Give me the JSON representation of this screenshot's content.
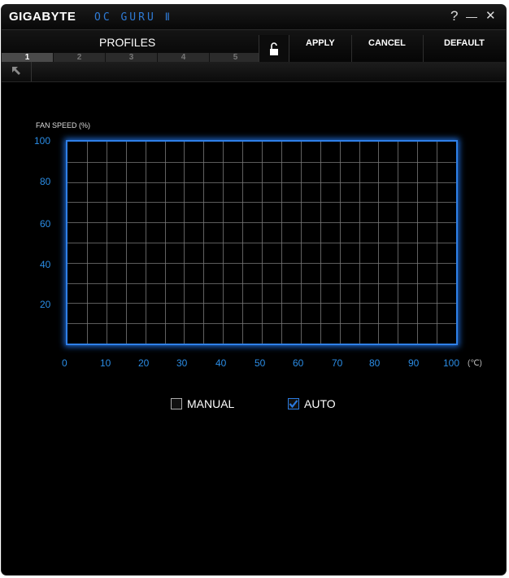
{
  "titlebar": {
    "brand": "GIGABYTE",
    "app_name": "OC GURU Ⅱ",
    "help_label": "?",
    "minimize_label": "—",
    "close_label": "✕"
  },
  "toolbar": {
    "profiles_label": "PROFILES",
    "apply_label": "APPLY",
    "cancel_label": "CANCEL",
    "default_label": "DEFAULT",
    "tabs": [
      "1",
      "2",
      "3",
      "4",
      "5"
    ],
    "active_tab": "1"
  },
  "chart_data": {
    "type": "line",
    "title": "FAN SPEED (%)",
    "x_unit": "(℃)",
    "x_ticks": [
      "0",
      "10",
      "20",
      "30",
      "40",
      "50",
      "60",
      "70",
      "80",
      "90",
      "100"
    ],
    "y_ticks": [
      "100",
      "80",
      "60",
      "40",
      "20"
    ],
    "xlim": [
      0,
      100
    ],
    "ylim": [
      0,
      100
    ],
    "grid": true,
    "series": []
  },
  "modes": {
    "manual": {
      "label": "MANUAL",
      "checked": false
    },
    "auto": {
      "label": "AUTO",
      "checked": true
    }
  },
  "colors": {
    "accent": "#2f80e8",
    "background": "#000000"
  }
}
